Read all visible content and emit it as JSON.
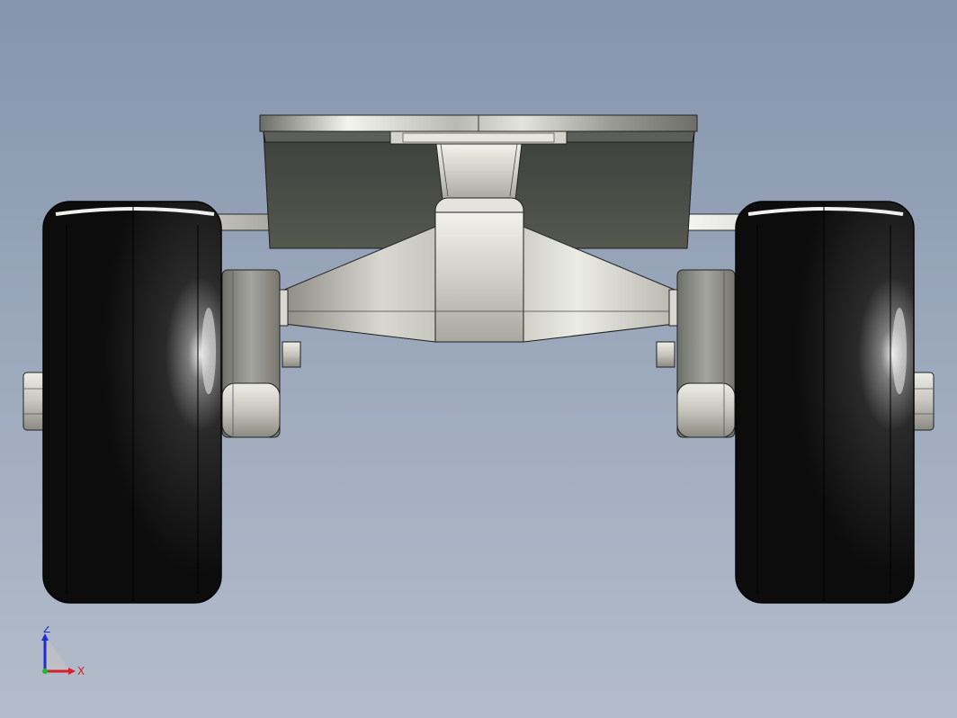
{
  "viewport": {
    "background_top": "#8595ac",
    "background_bottom": "#b4bccb"
  },
  "model": {
    "wheel_color": "#141414",
    "metal_color": "#c9c9c2",
    "dark_metal_color": "#4e514c"
  },
  "triad": {
    "z_label": "Z",
    "x_label": "X",
    "z_color": "#1f2ccf",
    "x_color": "#d8202a",
    "origin_color": "#1cbc2a"
  }
}
